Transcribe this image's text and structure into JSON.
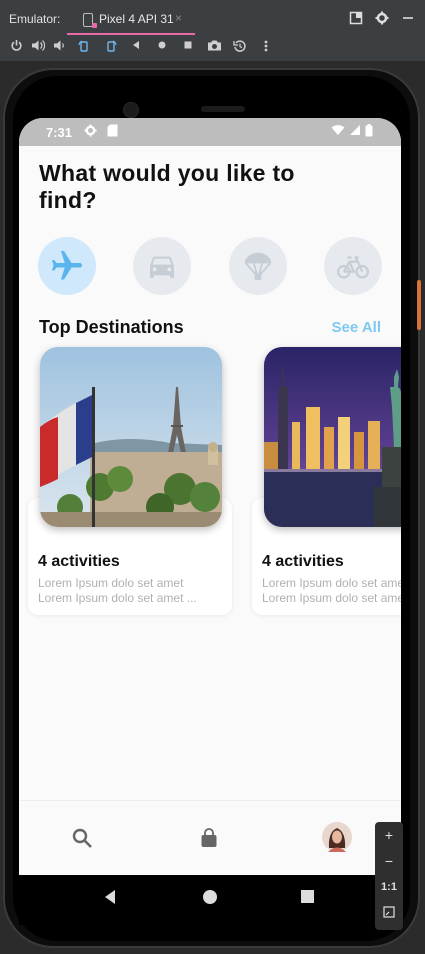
{
  "emulator": {
    "title": "Emulator:",
    "tab_label": "Pixel 4 API 31",
    "tab_close": "×",
    "zoom_in": "+",
    "zoom_out": "−",
    "zoom_actual": "1:1"
  },
  "status": {
    "time": "7:31"
  },
  "app": {
    "heading": "What would you like to find?",
    "categories": [
      "airplane-icon",
      "car-icon",
      "parachute-icon",
      "bicycle-icon"
    ],
    "section_title": "Top Destinations",
    "see_all": "See All",
    "destinations": [
      {
        "activities": "4 activities",
        "desc_line1": "Lorem Ipsum dolo set amet",
        "desc_line2": "Lorem Ipsum dolo set amet ..."
      },
      {
        "activities": "4 activities",
        "desc_line1": "Lorem Ipsum dolo set amet",
        "desc_line2": "Lorem Ipsum dolo set amet ..."
      }
    ],
    "nav": [
      "search-icon",
      "bag-icon",
      "profile-avatar"
    ]
  },
  "colors": {
    "accent": "#7fc8f2",
    "active_category_bg": "#cfe8fb",
    "category_bg": "#e6eaef",
    "tab_underline": "#e86aa8"
  }
}
